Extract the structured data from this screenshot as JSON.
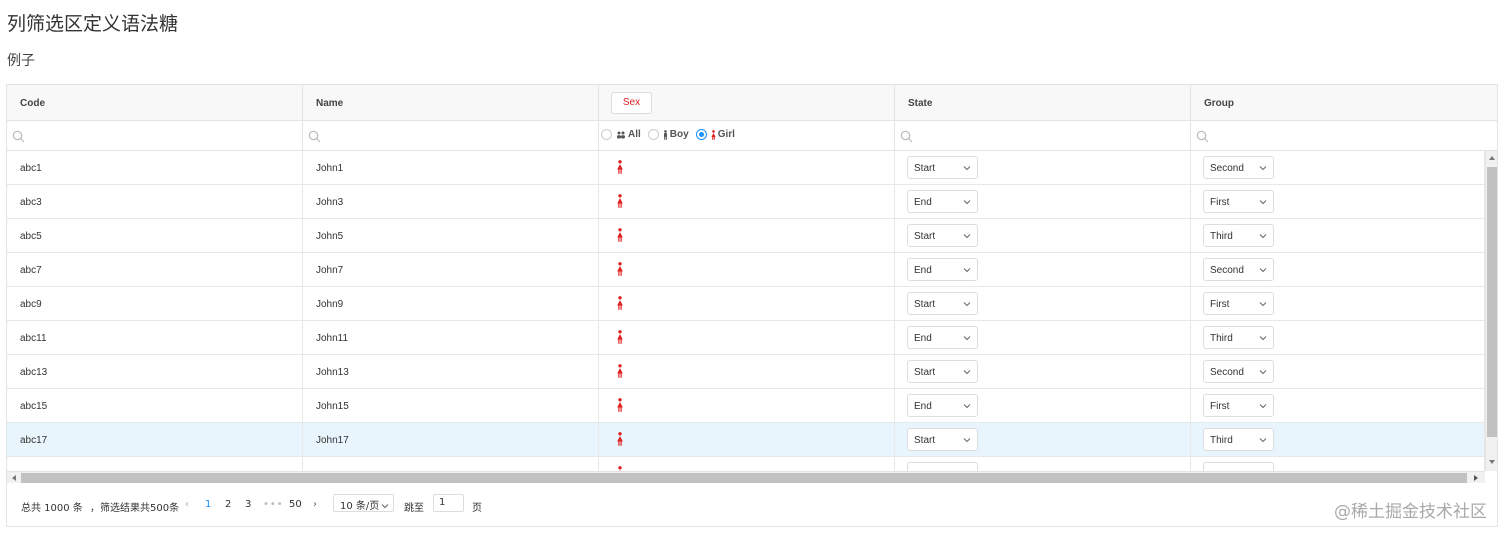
{
  "page": {
    "title": "列筛选区定义语法糖",
    "section": "例子"
  },
  "table": {
    "columns": [
      "Code",
      "Name",
      "Sex",
      "State",
      "Group"
    ],
    "sex_filter": {
      "options": [
        "All",
        "Boy",
        "Girl"
      ],
      "selected": "Girl"
    },
    "rows": [
      {
        "code": "abc1",
        "name": "John1",
        "sex": "girl",
        "state": "Start",
        "group": "Second"
      },
      {
        "code": "abc3",
        "name": "John3",
        "sex": "girl",
        "state": "End",
        "group": "First"
      },
      {
        "code": "abc5",
        "name": "John5",
        "sex": "girl",
        "state": "Start",
        "group": "Third"
      },
      {
        "code": "abc7",
        "name": "John7",
        "sex": "girl",
        "state": "End",
        "group": "Second"
      },
      {
        "code": "abc9",
        "name": "John9",
        "sex": "girl",
        "state": "Start",
        "group": "First"
      },
      {
        "code": "abc11",
        "name": "John11",
        "sex": "girl",
        "state": "End",
        "group": "Third"
      },
      {
        "code": "abc13",
        "name": "John13",
        "sex": "girl",
        "state": "Start",
        "group": "Second"
      },
      {
        "code": "abc15",
        "name": "John15",
        "sex": "girl",
        "state": "End",
        "group": "First"
      },
      {
        "code": "abc17",
        "name": "John17",
        "sex": "girl",
        "state": "Start",
        "group": "Third",
        "highlighted": true
      }
    ]
  },
  "pagination": {
    "total": "总共 1000 条",
    "filtered": "，筛选结果共500条",
    "pages": [
      "1",
      "2",
      "3"
    ],
    "current": "1",
    "ellipsis": "•••",
    "last": "50",
    "page_size": "10 条/页",
    "jump_label": "跳至",
    "jump_value": "1",
    "page_label": "页"
  },
  "watermark": "@稀土掘金技术社区",
  "colors": {
    "accent": "#1890ff",
    "girl_icon": "#e02020",
    "row_highlight": "#e8f5fd",
    "header_bg": "#f8f8f8"
  },
  "icons": [
    "search-icon",
    "girl-icon",
    "boy-icon",
    "people-icon",
    "chevron-down-icon",
    "chevron-left-icon",
    "chevron-right-icon"
  ]
}
